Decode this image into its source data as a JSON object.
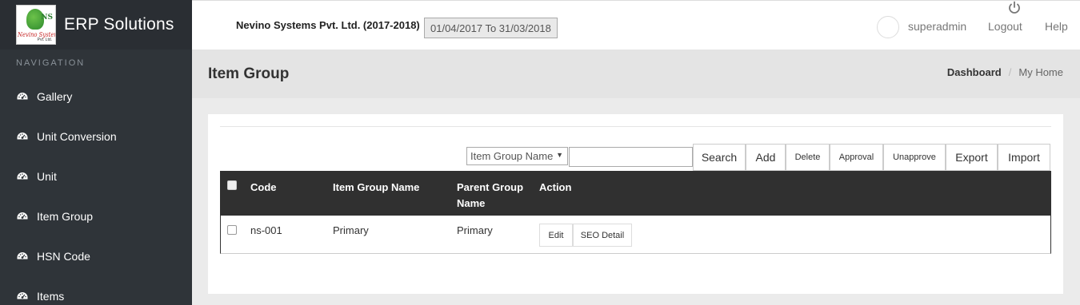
{
  "brand": {
    "title": "ERP Solutions",
    "logo_text_ns": "NS",
    "logo_text_company": "Nevino Systems",
    "logo_text_pvt": "Pvt. Ltd."
  },
  "sidebar": {
    "heading": "NAVIGATION",
    "items": [
      {
        "label": "Gallery"
      },
      {
        "label": "Unit Conversion"
      },
      {
        "label": "Unit"
      },
      {
        "label": "Item Group"
      },
      {
        "label": "HSN Code"
      },
      {
        "label": "Items"
      }
    ]
  },
  "topbar": {
    "company": "Nevino Systems Pvt. Ltd. (2017-2018)",
    "date_range": "01/04/2017 To 31/03/2018",
    "username": "superadmin",
    "logout": "Logout",
    "help": "Help"
  },
  "page": {
    "title": "Item Group",
    "breadcrumb": [
      "Dashboard",
      "My Home"
    ]
  },
  "toolbar": {
    "filter_selected": "Item Group Name",
    "search_value": "",
    "search_label": "Search",
    "add_label": "Add",
    "delete_label": "Delete",
    "approval_label": "Approval",
    "unapprove_label": "Unapprove",
    "export_label": "Export",
    "import_label": "Import"
  },
  "table": {
    "columns": [
      "Code",
      "Item Group Name",
      "Parent Group",
      "Name",
      "Action"
    ],
    "rows": [
      {
        "code": "ns-001",
        "item_group_name": "Primary",
        "parent_group_name": "Primary",
        "actions": [
          "Edit",
          "SEO Detail"
        ]
      }
    ]
  },
  "colors": {
    "sidebar_bg": "#2f3439",
    "table_header_bg": "#303030",
    "page_bg": "#ebebeb"
  }
}
